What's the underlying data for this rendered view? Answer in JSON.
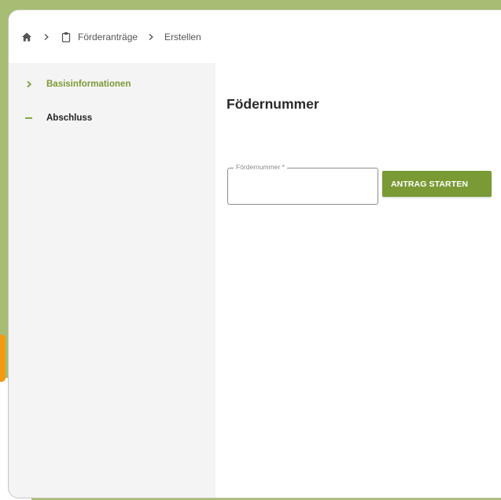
{
  "breadcrumb": {
    "home_icon": "home-icon",
    "separator_icon": "chevron-right-icon",
    "section_icon": "clipboard-icon",
    "section_label": "Förderanträge",
    "current_label": "Erstellen"
  },
  "sidebar": {
    "items": [
      {
        "label": "Basisinformationen",
        "state": "active",
        "marker_icon": "chevron-right-icon"
      },
      {
        "label": "Abschluss",
        "state": "inactive",
        "marker_icon": "dash-icon"
      }
    ]
  },
  "main": {
    "title": "Födernummer",
    "field": {
      "label": "Fördernummer *",
      "value": ""
    },
    "start_button_label": "ANTRAG STARTEN"
  },
  "colors": {
    "accent": "#7a9a35",
    "page_background": "#a7bd74",
    "sidebar_background": "#f4f4f4",
    "side_tab": "#f29b12"
  }
}
